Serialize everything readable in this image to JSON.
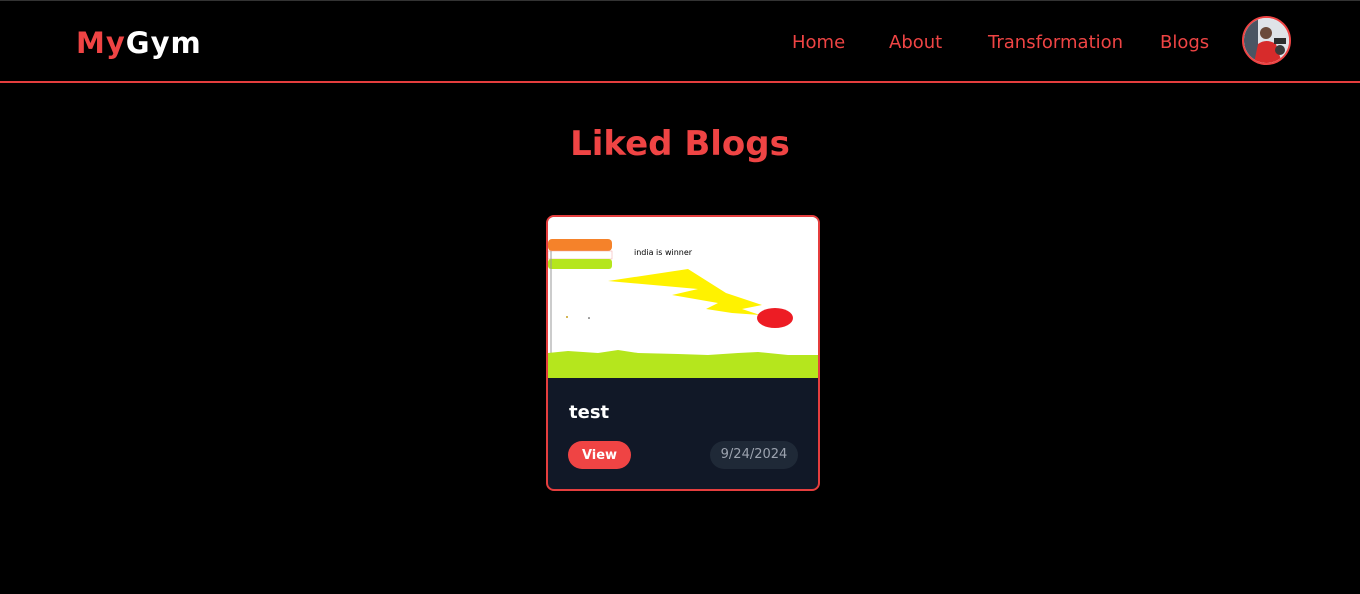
{
  "brand": {
    "part1": "My",
    "part2": "Gym"
  },
  "nav": {
    "home": "Home",
    "about": "About",
    "transformation": "Transformation",
    "blogs": "Blogs"
  },
  "page": {
    "title": "Liked Blogs"
  },
  "blogs": [
    {
      "title": "test",
      "image_text": "india is winner",
      "view_label": "View",
      "date": "9/24/2024"
    }
  ],
  "colors": {
    "accent": "#ef4444",
    "background": "#000000",
    "card_bg": "#111827",
    "badge_bg": "#1f2937"
  }
}
